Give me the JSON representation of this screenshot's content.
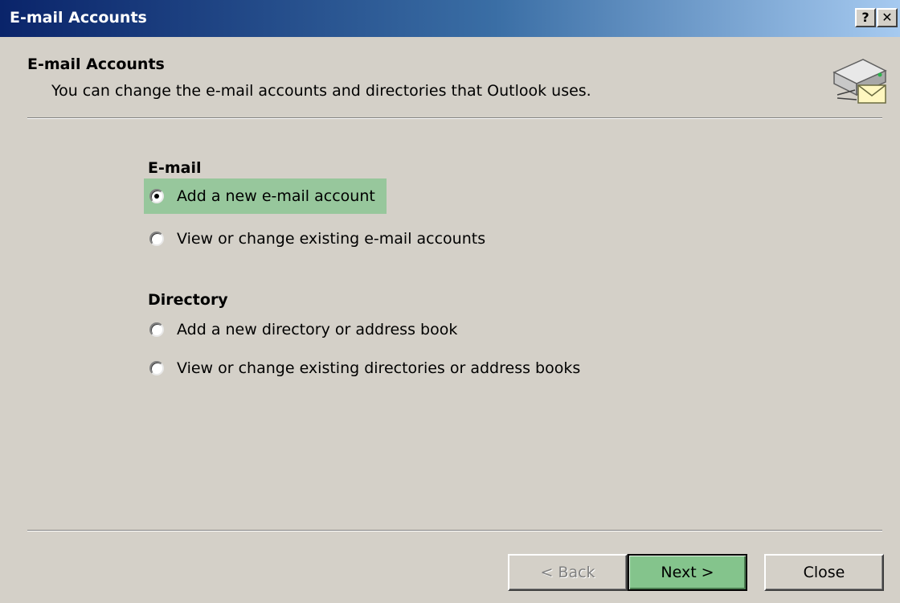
{
  "window": {
    "title": "E-mail Accounts",
    "help_glyph": "?",
    "close_glyph": "✕"
  },
  "header": {
    "title": "E-mail Accounts",
    "subtitle": "You can change the e-mail accounts and directories that Outlook uses.",
    "icon": "mail-server-icon"
  },
  "email_group": {
    "label": "E-mail",
    "options": [
      {
        "label": "Add a new e-mail account",
        "selected": true
      },
      {
        "label": "View or change existing e-mail accounts",
        "selected": false
      }
    ]
  },
  "directory_group": {
    "label": "Directory",
    "options": [
      {
        "label": "Add a new directory or address book",
        "selected": false
      },
      {
        "label": "View or change existing directories or address books",
        "selected": false
      }
    ]
  },
  "buttons": {
    "back": "< Back",
    "next": "Next >",
    "close": "Close"
  },
  "colors": {
    "dialog_bg": "#d4d0c8",
    "titlebar_start": "#0a246a",
    "highlight": "#97c79c",
    "next_button": "#84c48c"
  }
}
